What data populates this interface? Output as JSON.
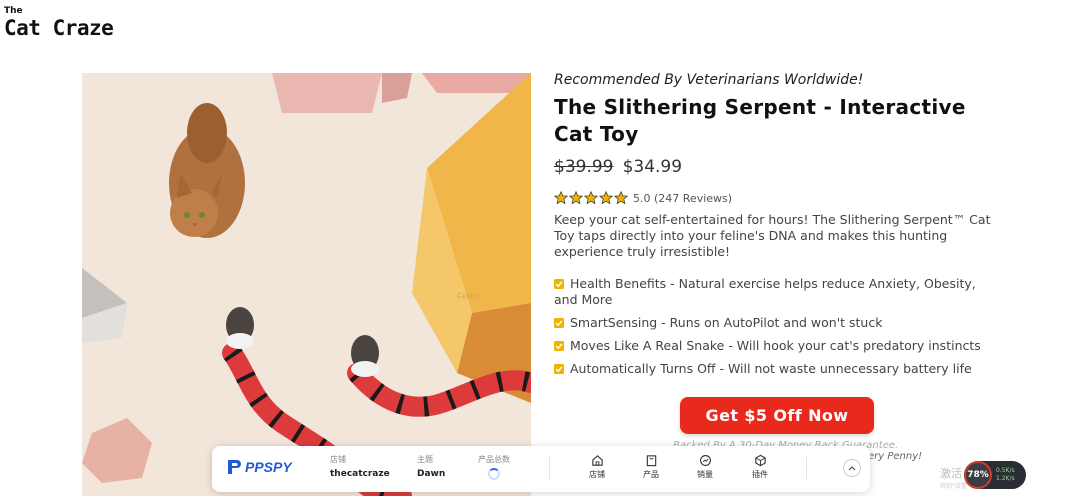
{
  "brand": {
    "top": "The",
    "name": "Cat Craze"
  },
  "product": {
    "tagline": "Recommended By Veterinarians Worldwide!",
    "title": "The Slithering Serpent - Interactive Cat Toy",
    "old_price": "$39.99",
    "price": "$34.99",
    "rating_value": 5.0,
    "rating_text": "5.0 (247 Reviews)",
    "description": "Keep your cat self-entertained for hours! The Slithering Serpent™ Cat Toy taps directly into your feline's DNA and makes this hunting experience truly irresistible!",
    "features": [
      "Health Benefits - Natural exercise helps reduce Anxiety, Obesity, and More",
      "SmartSensing - Runs on AutoPilot and won't stuck",
      "Moves Like A Real Snake - Will hook your cat's predatory instincts",
      "Automatically Turns Off - Will not waste unnecessary battery life"
    ],
    "cta_label": "Get $5 Off Now",
    "guarantee_text": "Backed By A 30-Day Money Back Guarantee.",
    "penny_text": "ery Penny!",
    "photo_watermark": "Feeko"
  },
  "ppspy": {
    "logo": "PPSPY",
    "store_label": "店铺",
    "store_value": "thecatcraze",
    "theme_label": "主题",
    "theme_value": "Dawn",
    "products_label": "产品总数",
    "buttons": [
      "店铺",
      "产品",
      "销量",
      "插件"
    ]
  },
  "system": {
    "activate_text": "激活 Windows",
    "activate_sub": "转到\"设置\"以激活 Windows。",
    "perf_value": "78%",
    "perf_up": "0.5K/s",
    "perf_down": "1.2K/s"
  },
  "colors": {
    "cta": "#e8291c",
    "ppspy_blue": "#1f5bd6",
    "star": "#f0b400",
    "check": "#f0b400"
  }
}
